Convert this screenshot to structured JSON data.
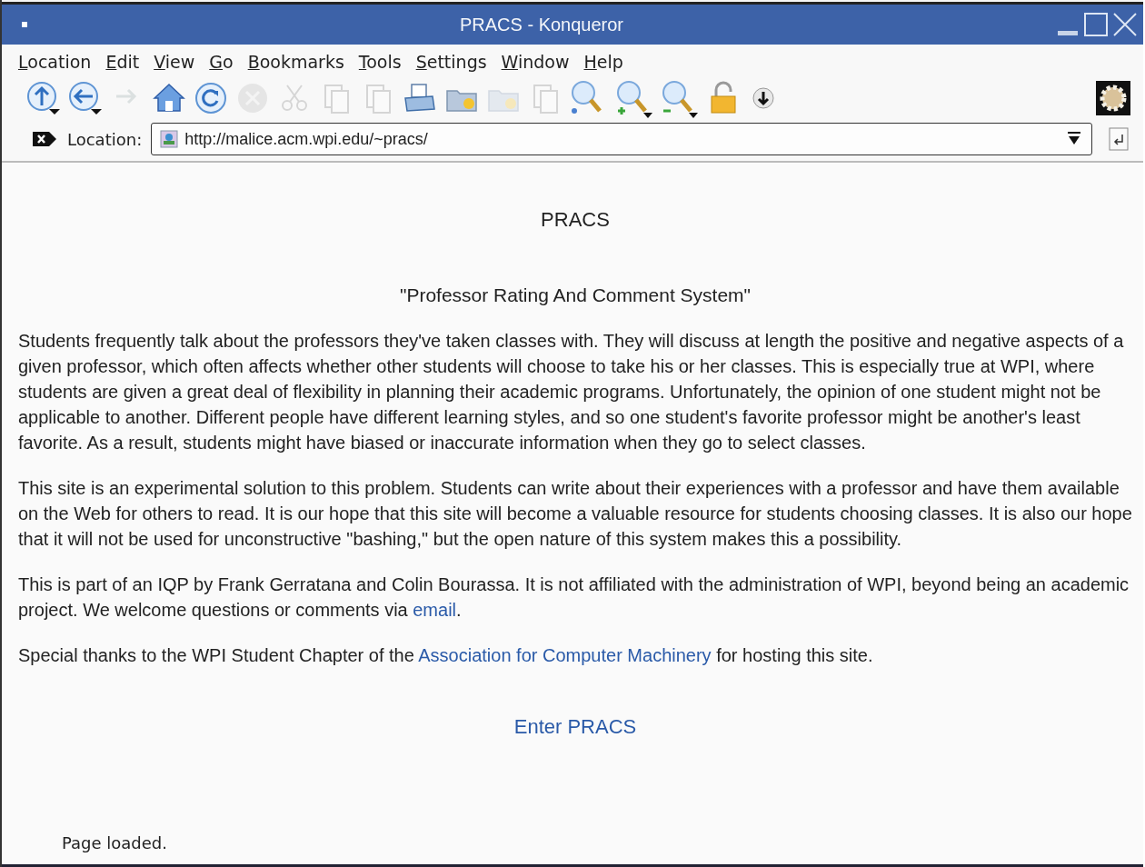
{
  "window": {
    "title": "PRACS - Konqueror"
  },
  "menu": [
    "Location",
    "Edit",
    "View",
    "Go",
    "Bookmarks",
    "Tools",
    "Settings",
    "Window",
    "Help"
  ],
  "toolbar": [
    {
      "kind": "up",
      "disabled": false
    },
    {
      "kind": "back",
      "disabled": false
    },
    {
      "kind": "forward",
      "disabled": true
    },
    {
      "kind": "home",
      "disabled": false
    },
    {
      "kind": "reload",
      "disabled": false
    },
    {
      "kind": "stop",
      "disabled": true
    },
    {
      "kind": "cut",
      "disabled": true
    },
    {
      "kind": "copy",
      "disabled": true
    },
    {
      "kind": "paste",
      "disabled": true
    },
    {
      "kind": "print",
      "disabled": false
    },
    {
      "kind": "folder",
      "disabled": false
    },
    {
      "kind": "folder",
      "disabled": true
    },
    {
      "kind": "copy",
      "disabled": true
    },
    {
      "kind": "zoom",
      "disabled": false
    },
    {
      "kind": "zoom-in",
      "disabled": false
    },
    {
      "kind": "zoom-out",
      "disabled": false
    },
    {
      "kind": "lock",
      "disabled": false
    },
    {
      "kind": "download",
      "disabled": false
    }
  ],
  "location": {
    "label": "Location:",
    "value": "http://malice.acm.wpi.edu/~pracs/"
  },
  "page": {
    "heading": "PRACS",
    "subtitle": "\"Professor Rating And Comment System\"",
    "paragraphs": [
      [
        {
          "text": "Students frequently talk about the professors they've taken classes with. They will discuss at length the positive and negative aspects of a given professor, which often affects whether other students will choose to take his or her classes. This is especially true at WPI, where students are given a great deal of flexibility in planning their academic programs. Unfortunately, the opinion of one student might not be applicable to another. Different people have different learning styles, and so one student's favorite professor might be another's least favorite. As a result, students might have biased or inaccurate information when they go to select classes."
        }
      ],
      [
        {
          "text": "This site is an experimental solution to this problem. Students can write about their experiences with a professor and have them available on the Web for others to read. It is our hope that this site will become a valuable resource for students choosing classes. It is also our hope that it will not be used for unconstructive \"bashing,\" but the open nature of this system makes this a possibility."
        }
      ],
      [
        {
          "text": "This is part of an IQP by Frank Gerratana and Colin Bourassa. It is not affiliated with the administration of WPI, beyond being an academic project. We welcome questions or comments via "
        },
        {
          "link": "email"
        },
        {
          "text": "."
        }
      ],
      [
        {
          "text": "Special thanks to the WPI Student Chapter of the "
        },
        {
          "link": "Association for Computer Machinery"
        },
        {
          "text": " for hosting this site."
        }
      ]
    ],
    "enter_link": "Enter PRACS"
  },
  "status_bar": "Page loaded."
}
